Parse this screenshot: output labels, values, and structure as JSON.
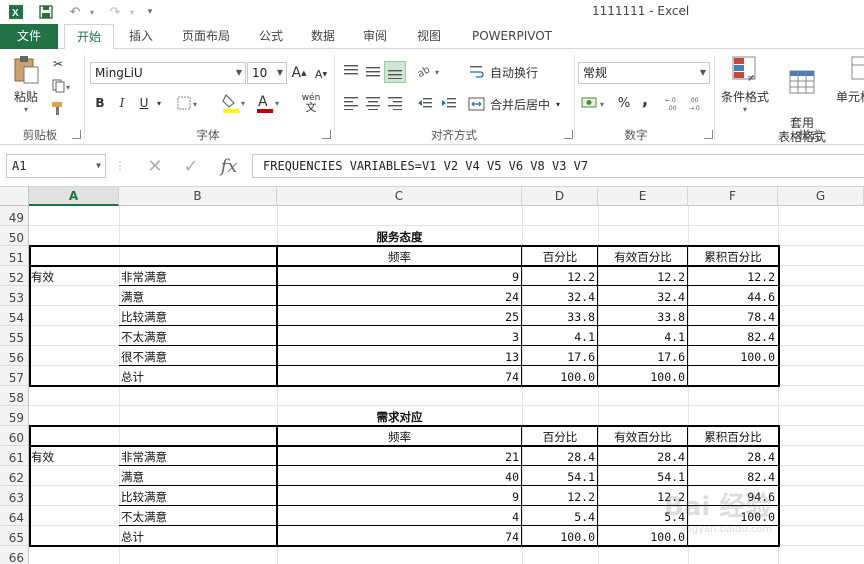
{
  "window": {
    "title": "1111111 - Excel"
  },
  "tabs": [
    "文件",
    "开始",
    "插入",
    "页面布局",
    "公式",
    "数据",
    "审阅",
    "视图",
    "POWERPIVOT"
  ],
  "ribbon": {
    "clipboard": {
      "label": "剪贴板",
      "paste": "粘贴"
    },
    "font": {
      "label": "字体",
      "name": "MingLiU",
      "size": "10",
      "bold": "B",
      "italic": "I",
      "underline": "U",
      "grow": "A",
      "shrink": "A",
      "phonetic": "wén"
    },
    "align": {
      "label": "对齐方式",
      "wrap": "自动换行",
      "merge": "合并后居中"
    },
    "number": {
      "label": "数字",
      "format": "常规",
      "percent": "%",
      "comma": ","
    },
    "styles": {
      "label": "样式",
      "conditional": "条件格式",
      "table_fmt": "套用\n表格格式",
      "cell_styles": "单元格"
    }
  },
  "formula_bar": {
    "namebox": "A1",
    "fx": "fx",
    "formula": "FREQUENCIES VARIABLES=V1 V2 V4 V5 V6 V8 V3 V7"
  },
  "columns": [
    "A",
    "B",
    "C",
    "D",
    "E",
    "F",
    "G"
  ],
  "rows": [
    "49",
    "50",
    "51",
    "52",
    "53",
    "54",
    "55",
    "56",
    "57",
    "58",
    "59",
    "60",
    "61",
    "62",
    "63",
    "64",
    "65",
    "66"
  ],
  "table1": {
    "title": "服务态度",
    "headers": {
      "freq": "频率",
      "pct": "百分比",
      "valid_pct": "有效百分比",
      "cum_pct": "累积百分比"
    },
    "group": "有效",
    "rows": [
      {
        "label": "非常满意",
        "freq": "9",
        "pct": "12.2",
        "valid": "12.2",
        "cum": "12.2"
      },
      {
        "label": "满意",
        "freq": "24",
        "pct": "32.4",
        "valid": "32.4",
        "cum": "44.6"
      },
      {
        "label": "比较满意",
        "freq": "25",
        "pct": "33.8",
        "valid": "33.8",
        "cum": "78.4"
      },
      {
        "label": "不太满意",
        "freq": "3",
        "pct": "4.1",
        "valid": "4.1",
        "cum": "82.4"
      },
      {
        "label": "很不满意",
        "freq": "13",
        "pct": "17.6",
        "valid": "17.6",
        "cum": "100.0"
      },
      {
        "label": "总计",
        "freq": "74",
        "pct": "100.0",
        "valid": "100.0",
        "cum": ""
      }
    ]
  },
  "table2": {
    "title": "需求对应",
    "headers": {
      "freq": "频率",
      "pct": "百分比",
      "valid_pct": "有效百分比",
      "cum_pct": "累积百分比"
    },
    "group": "有效",
    "rows": [
      {
        "label": "非常满意",
        "freq": "21",
        "pct": "28.4",
        "valid": "28.4",
        "cum": "28.4"
      },
      {
        "label": "满意",
        "freq": "40",
        "pct": "54.1",
        "valid": "54.1",
        "cum": "82.4"
      },
      {
        "label": "比较满意",
        "freq": "9",
        "pct": "12.2",
        "valid": "12.2",
        "cum": "94.6"
      },
      {
        "label": "不太满意",
        "freq": "4",
        "pct": "5.4",
        "valid": "5.4",
        "cum": "100.0"
      },
      {
        "label": "总计",
        "freq": "74",
        "pct": "100.0",
        "valid": "100.0",
        "cum": ""
      }
    ]
  },
  "watermark": {
    "text": "Bai 经验",
    "sub": "jingyan.baidu.com"
  },
  "colors": {
    "accent": "#217346",
    "font_red": "#c00000",
    "highlight": "#ffff00"
  }
}
